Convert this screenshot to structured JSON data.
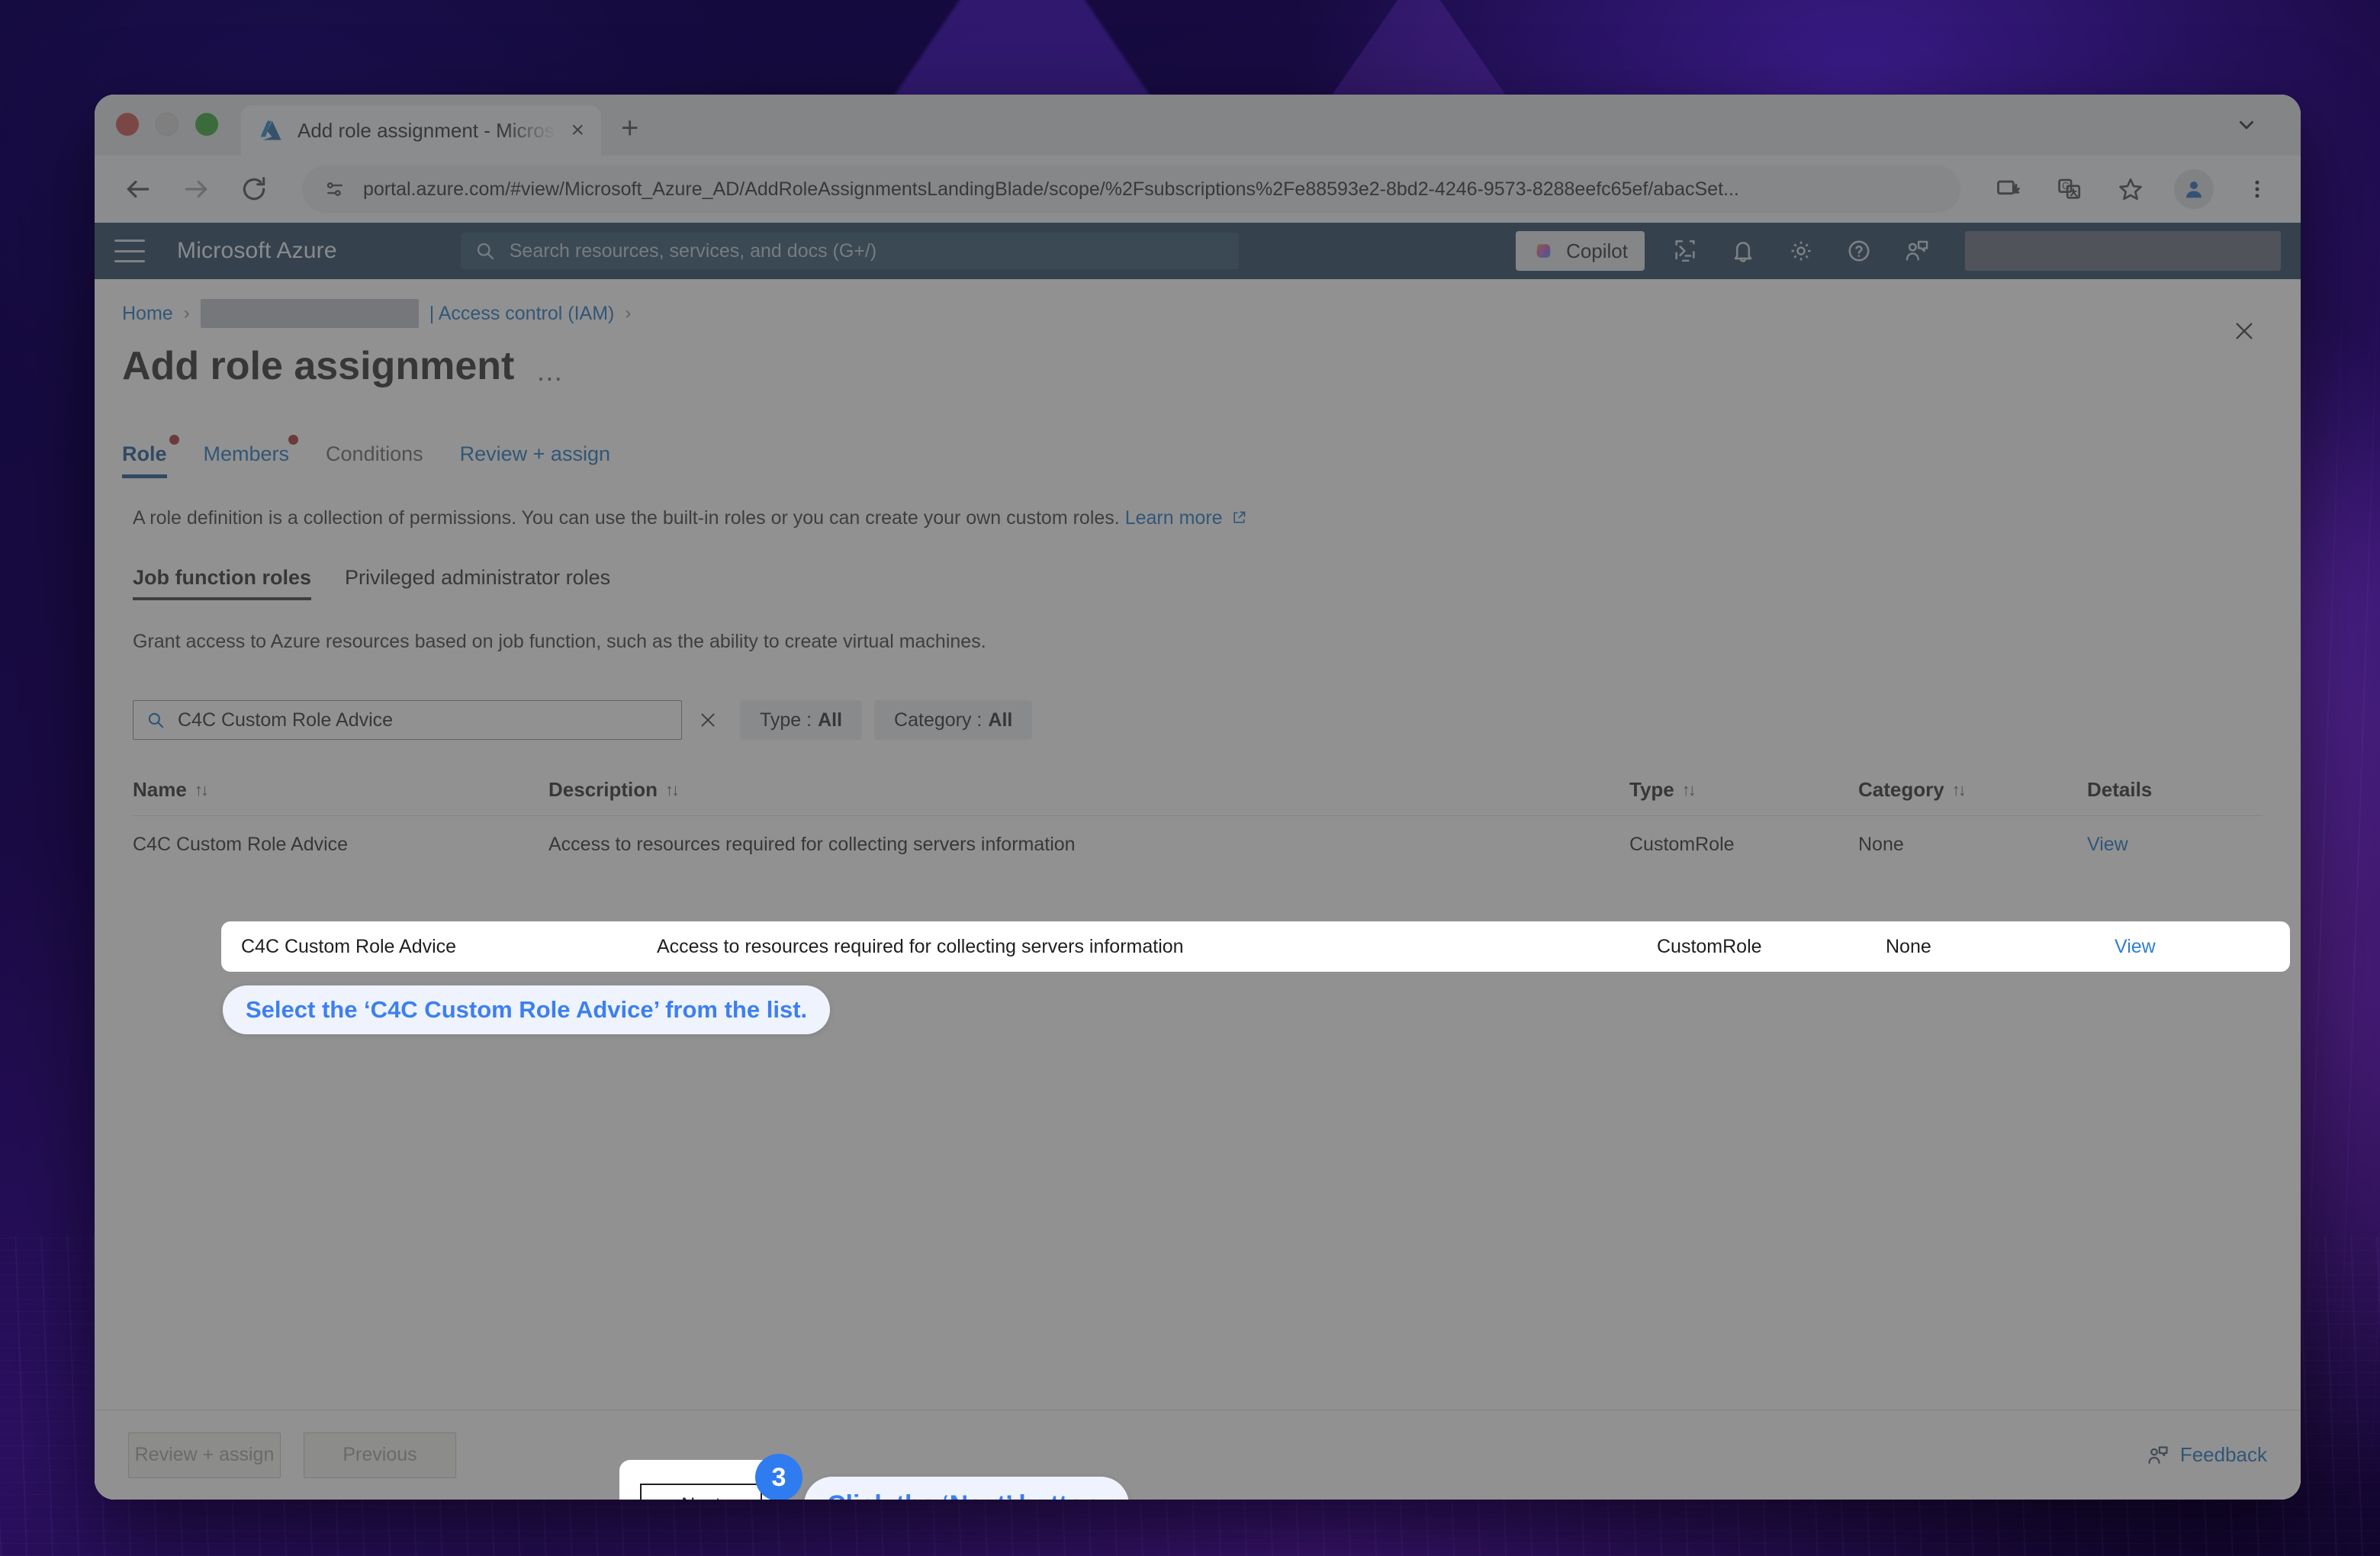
{
  "browser": {
    "tab": {
      "title": "Add role assignment - Micros",
      "favicon": "azure-logo-icon",
      "close": "×"
    },
    "new_tab_label": "+",
    "url": "portal.azure.com/#view/Microsoft_Azure_AD/AddRoleAssignmentsLandingBlade/scope/%2Fsubscriptions%2Fe88593e2-8bd2-4246-9573-8288eefc65ef/abacSet...",
    "toolbar_icons": [
      "back-arrow-icon",
      "forward-arrow-icon",
      "reload-icon",
      "site-settings-icon",
      "install-app-icon",
      "translate-icon",
      "bookmark-star-icon",
      "profile-avatar-icon",
      "overflow-menu-icon",
      "tab-search-chevron-icon"
    ]
  },
  "azure_nav": {
    "brand": "Microsoft Azure",
    "search_placeholder": "Search resources, services, and docs (G+/)",
    "copilot_label": "Copilot",
    "icons": [
      "hamburger-menu-icon",
      "search-icon",
      "cloud-shell-icon",
      "notifications-bell-icon",
      "settings-gear-icon",
      "help-question-icon",
      "feedback-smiley-icon"
    ],
    "account_redacted": ""
  },
  "breadcrumb": {
    "home": "Home",
    "redacted": "",
    "access_control": "| Access control (IAM)",
    "separator": "›"
  },
  "blade": {
    "title": "Add role assignment",
    "ellipsis": "…",
    "close_label": "✕"
  },
  "pivot_tabs": [
    {
      "label": "Role",
      "active": true,
      "required": true
    },
    {
      "label": "Members",
      "active": false,
      "required": true
    },
    {
      "label": "Conditions",
      "active": false,
      "required": false
    },
    {
      "label": "Review + assign",
      "active": false,
      "required": false
    }
  ],
  "intro": {
    "text": "A role definition is a collection of permissions. You can use the built-in roles or you can create your own custom roles.",
    "learn_more": "Learn more"
  },
  "sub_tabs": [
    {
      "label": "Job function roles",
      "active": true
    },
    {
      "label": "Privileged administrator roles",
      "active": false
    }
  ],
  "grant_text": "Grant access to Azure resources based on job function, such as the ability to create virtual machines.",
  "filters": {
    "search_value": "C4C Custom Role Advice",
    "clear_label": "✕",
    "type_label": "Type :",
    "type_value": "All",
    "category_label": "Category :",
    "category_value": "All"
  },
  "table": {
    "columns": [
      "Name",
      "Description",
      "Type",
      "Category",
      "Details"
    ],
    "sort_glyph": "↑↓",
    "rows": [
      {
        "name": "C4C Custom Role Advice",
        "description": "Access to resources required for collecting servers information",
        "type": "CustomRole",
        "category": "None",
        "details": "View"
      }
    ]
  },
  "footer": {
    "review_assign": "Review + assign",
    "previous": "Previous",
    "next": "Next",
    "feedback": "Feedback"
  },
  "callouts": [
    {
      "text": "Select the ‘C4C Custom Role Advice’ from the list."
    },
    {
      "text": "Click the ‘Next’ button."
    }
  ],
  "step_badge": "3",
  "colors": {
    "accent_blue": "#3d7ff0",
    "azure_nav": "#1b3a57",
    "link": "#0f6cbd",
    "required_dot": "#a4262c",
    "callout_bg": "#eef3fd"
  }
}
